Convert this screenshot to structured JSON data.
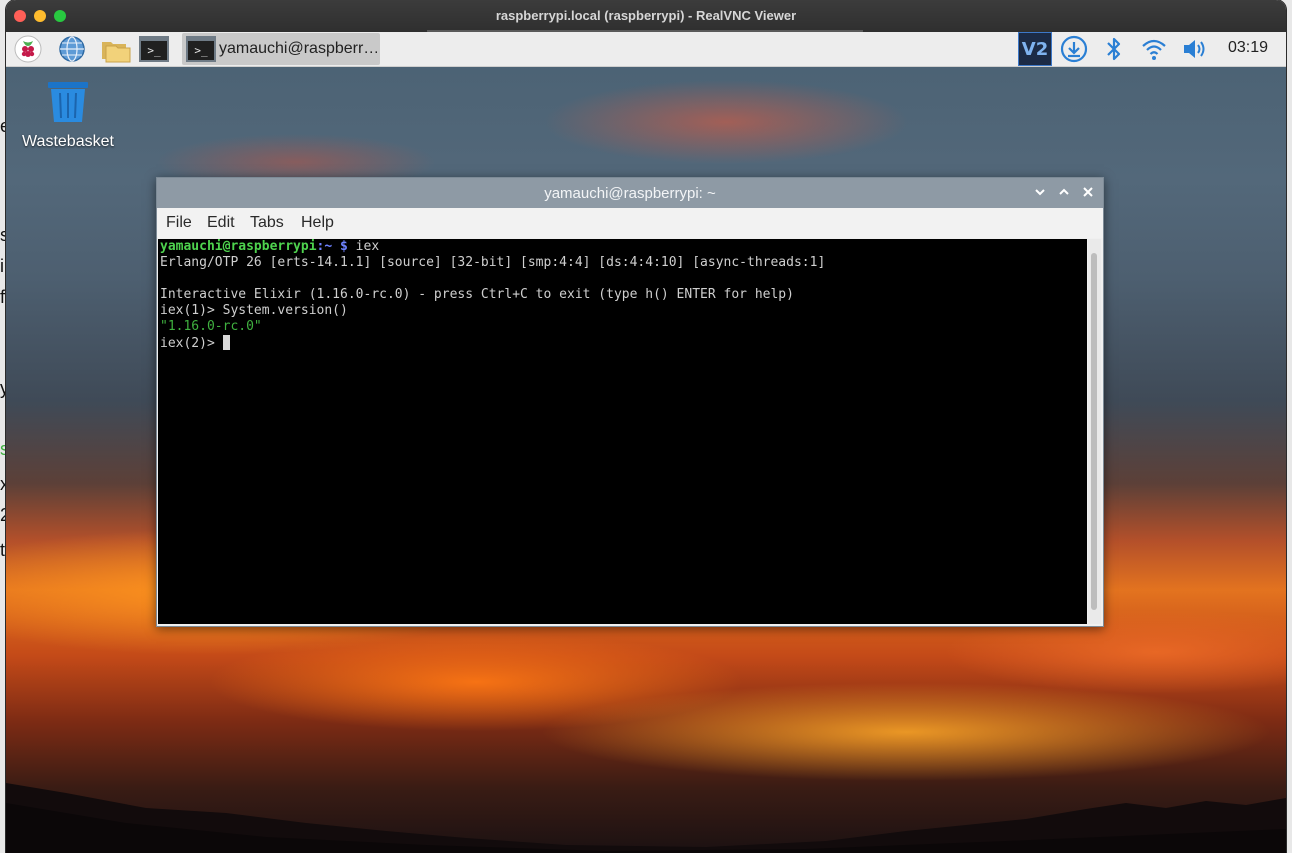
{
  "vnc": {
    "window_title": "raspberrypi.local (raspberrypi) - RealVNC Viewer"
  },
  "panel": {
    "launchers": [
      {
        "name": "raspberry-menu-icon"
      },
      {
        "name": "web-browser-icon"
      },
      {
        "name": "file-manager-icon"
      },
      {
        "name": "terminal-launcher-icon",
        "glyph": ">_"
      }
    ],
    "taskbar_window": {
      "label": "yamauchi@raspberr…",
      "glyph": ">_"
    },
    "tray": {
      "vnc_glyph": "V2",
      "clock": "03:19"
    }
  },
  "desktop": {
    "icons": [
      {
        "label": "Wastebasket"
      }
    ]
  },
  "terminal": {
    "title": "yamauchi@raspberrypi: ~",
    "menu": [
      "File",
      "Edit",
      "Tabs",
      "Help"
    ],
    "lines": {
      "l1_user": "yamauchi@raspberrypi",
      "l1_path": ":~ $",
      "l1_cmd": " iex",
      "l2": "Erlang/OTP 26 [erts-14.1.1] [source] [32-bit] [smp:4:4] [ds:4:4:10] [async-threads:1]",
      "l4": "Interactive Elixir (1.16.0-rc.0) - press Ctrl+C to exit (type h() ENTER for help)",
      "l5": "iex(1)> System.version()",
      "l6": "\"1.16.0-rc.0\"",
      "l7": "iex(2)> "
    }
  },
  "colors": {
    "prompt_user": "#4ed34e",
    "prompt_path": "#6e82ff",
    "output_green": "#3fb03f",
    "terminal_bg": "#000000",
    "titlebar": "#8e9aa5"
  }
}
